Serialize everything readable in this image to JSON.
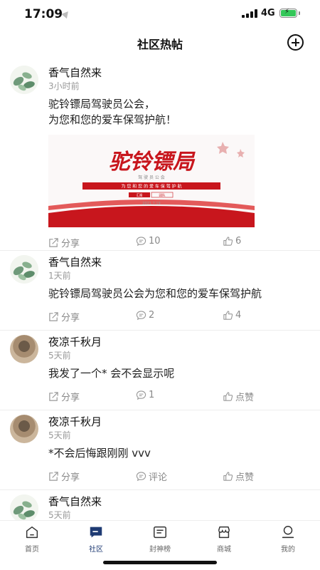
{
  "status_bar": {
    "time": "17:09",
    "network": "4G"
  },
  "header": {
    "title": "社区热帖"
  },
  "posts": [
    {
      "username": "香气自然来",
      "time": "3小时前",
      "content": "驼铃镖局驾驶员公会，\n为您和您的爱车保驾护航！",
      "image": {
        "title": "驼铃镖局",
        "subtitle": "驾 驶 员 公 会",
        "slogan": "为 您 和 您 的 爱 车 保 驾 护 航",
        "tag1": "汇报",
        "tag2": "团队",
        "date": "2021.7.19"
      },
      "share_label": "分享",
      "comment_label": "10",
      "like_label": "6"
    },
    {
      "username": "香气自然来",
      "time": "1天前",
      "content": "驼铃镖局驾驶员公会为您和您的爱车保驾护航",
      "share_label": "分享",
      "comment_label": "2",
      "like_label": "4"
    },
    {
      "username": "夜凉千秋月",
      "time": "5天前",
      "content": "我发了一个*  会不会显示呢",
      "share_label": "分享",
      "comment_label": "1",
      "like_label": "点赞"
    },
    {
      "username": "夜凉千秋月",
      "time": "5天前",
      "content": "*不会后悔跟刚刚 vvv",
      "share_label": "分享",
      "comment_label": "评论",
      "like_label": "点赞"
    },
    {
      "username": "香气自然来",
      "time": "5天前"
    }
  ],
  "nav": {
    "home": "首页",
    "community": "社区",
    "ranking": "封神榜",
    "mall": "商城",
    "mine": "我的"
  },
  "colors": {
    "accent": "#1f3b73",
    "poster_red": "#c8161d"
  }
}
